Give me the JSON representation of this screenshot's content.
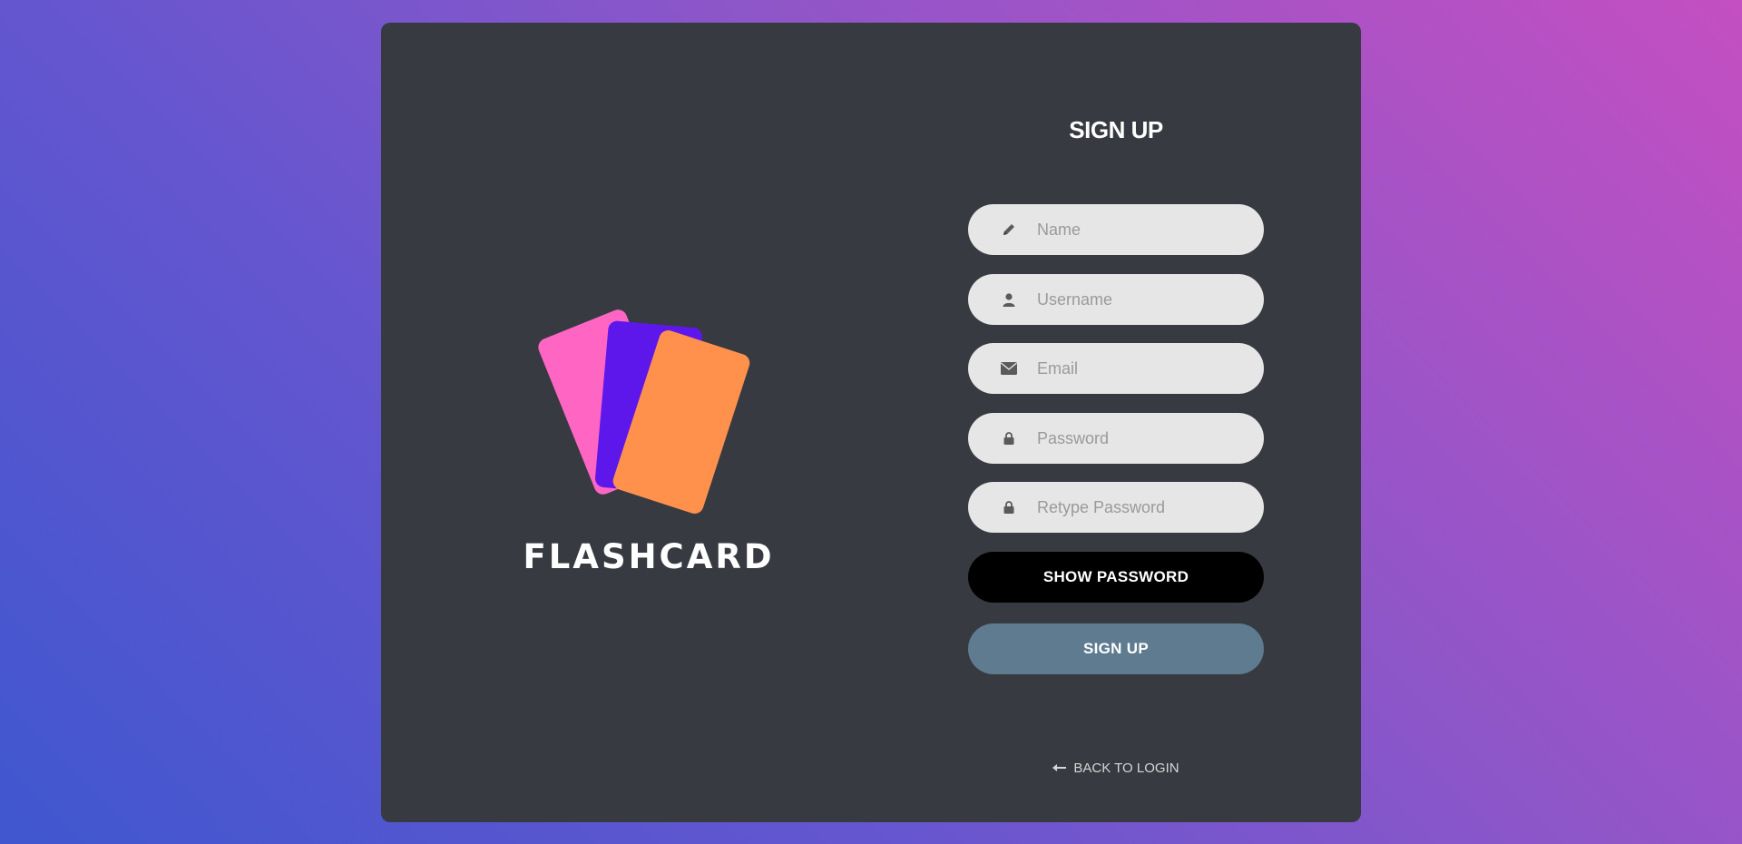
{
  "brand": {
    "name": "FLASHCARD",
    "colors": {
      "pink": "#ff66c4",
      "purple": "#5e17eb",
      "orange": "#ff914d"
    }
  },
  "form": {
    "title": "SIGN UP",
    "fields": [
      {
        "icon": "pencil-icon",
        "placeholder": "Name",
        "type": "text",
        "value": ""
      },
      {
        "icon": "user-icon",
        "placeholder": "Username",
        "type": "text",
        "value": ""
      },
      {
        "icon": "envelope-icon",
        "placeholder": "Email",
        "type": "email",
        "value": ""
      },
      {
        "icon": "lock-icon",
        "placeholder": "Password",
        "type": "password",
        "value": ""
      },
      {
        "icon": "lock-icon",
        "placeholder": "Retype Password",
        "type": "password",
        "value": ""
      }
    ],
    "show_password_label": "SHOW PASSWORD",
    "signup_label": "SIGN UP",
    "back_link_label": "BACK TO LOGIN",
    "back_link_icon": "arrow-left-icon"
  },
  "colors": {
    "card_background": "#373a41",
    "field_background": "#e6e6e6",
    "show_button": "#000000",
    "signup_button": "#5f7b8f"
  }
}
